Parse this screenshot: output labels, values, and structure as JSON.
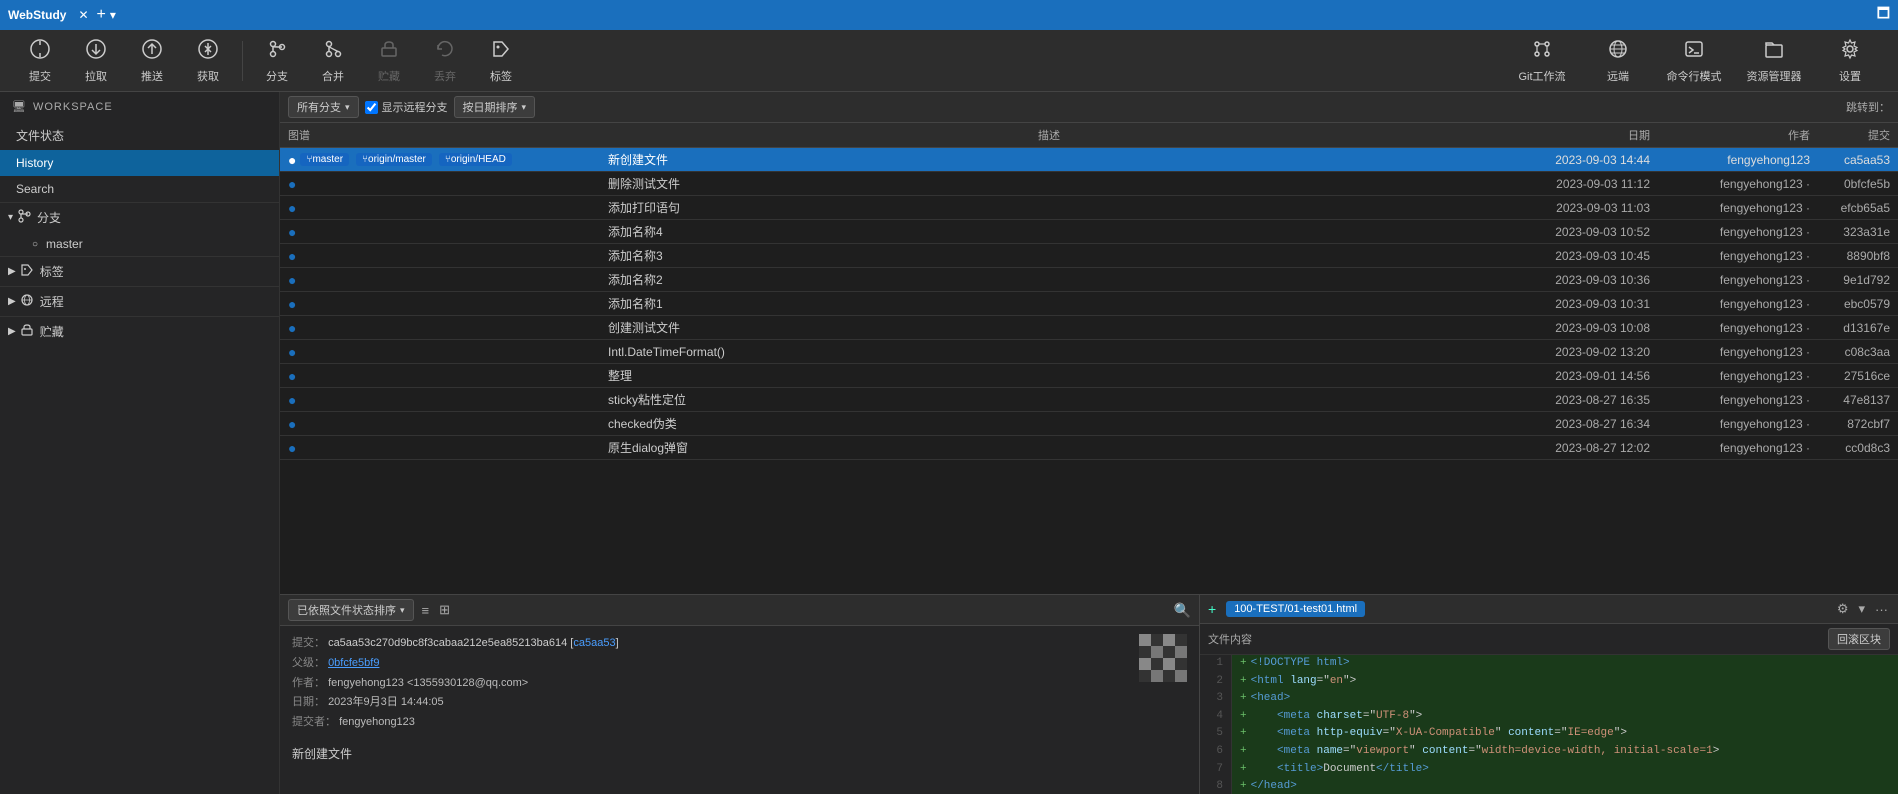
{
  "titleBar": {
    "title": "WebStudy",
    "addLabel": "+",
    "dropdownLabel": "▾",
    "maximizeLabel": "🗖"
  },
  "toolbar": {
    "items": [
      {
        "id": "commit",
        "icon": "⊕",
        "label": "提交"
      },
      {
        "id": "pull",
        "icon": "⬇",
        "label": "拉取"
      },
      {
        "id": "push",
        "icon": "⬆",
        "label": "推送"
      },
      {
        "id": "fetch",
        "icon": "⬇⬆",
        "label": "获取"
      },
      {
        "id": "branch",
        "icon": "⑂",
        "label": "分支"
      },
      {
        "id": "merge",
        "icon": "⑃",
        "label": "合并"
      },
      {
        "id": "stash",
        "icon": "☁",
        "label": "贮藏"
      },
      {
        "id": "discard",
        "icon": "↺",
        "label": "丢弃"
      },
      {
        "id": "tag",
        "icon": "⬡",
        "label": "标签"
      }
    ],
    "rightItems": [
      {
        "id": "gitflow",
        "icon": "⑂⑂",
        "label": "Git工作流"
      },
      {
        "id": "remote",
        "icon": "🌐",
        "label": "远端"
      },
      {
        "id": "terminal",
        "icon": "⌨",
        "label": "命令行模式"
      },
      {
        "id": "filemanager",
        "icon": "📁",
        "label": "资源管理器"
      },
      {
        "id": "settings",
        "icon": "⚙",
        "label": "设置"
      }
    ]
  },
  "sidebar": {
    "workspaceLabel": "WORKSPACE",
    "fileStatusLabel": "文件状态",
    "historyLabel": "History",
    "searchLabel": "Search",
    "groups": [
      {
        "id": "branch",
        "icon": "⑂",
        "label": "分支",
        "expanded": true,
        "items": [
          {
            "id": "master",
            "label": "master",
            "active": true
          }
        ]
      },
      {
        "id": "tags",
        "icon": "⬡",
        "label": "标签",
        "expanded": false,
        "items": []
      },
      {
        "id": "remote",
        "icon": "☁",
        "label": "远程",
        "expanded": false,
        "items": []
      },
      {
        "id": "stash",
        "icon": "📦",
        "label": "贮藏",
        "expanded": false,
        "items": []
      }
    ]
  },
  "commitPane": {
    "filterLabel": "所有分支",
    "showRemoteLabel": "显示远程分支",
    "sortLabel": "按日期排序",
    "jumpToLabel": "跳转到：",
    "columns": {
      "graph": "图谱",
      "desc": "描述",
      "date": "日期",
      "author": "作者",
      "commit": "提交"
    },
    "commits": [
      {
        "id": "c1",
        "selected": true,
        "hasBranches": true,
        "branches": [
          "master",
          "origin/master",
          "origin/HEAD"
        ],
        "desc": "新创建文件",
        "date": "2023-09-03 14:44",
        "author": "fengyehong123",
        "commitHash": "ca5aa53"
      },
      {
        "id": "c2",
        "selected": false,
        "hasBranches": false,
        "branches": [],
        "desc": "删除测试文件",
        "date": "2023-09-03 11:12",
        "author": "fengyehong123 ·",
        "commitHash": "0bfcfe5b"
      },
      {
        "id": "c3",
        "selected": false,
        "hasBranches": false,
        "branches": [],
        "desc": "添加打印语句",
        "date": "2023-09-03 11:03",
        "author": "fengyehong123 ·",
        "commitHash": "efcb65a5"
      },
      {
        "id": "c4",
        "selected": false,
        "hasBranches": false,
        "branches": [],
        "desc": "添加名称4",
        "date": "2023-09-03 10:52",
        "author": "fengyehong123 ·",
        "commitHash": "323a31e"
      },
      {
        "id": "c5",
        "selected": false,
        "hasBranches": false,
        "branches": [],
        "desc": "添加名称3",
        "date": "2023-09-03 10:45",
        "author": "fengyehong123 ·",
        "commitHash": "8890bf8"
      },
      {
        "id": "c6",
        "selected": false,
        "hasBranches": false,
        "branches": [],
        "desc": "添加名称2",
        "date": "2023-09-03 10:36",
        "author": "fengyehong123 ·",
        "commitHash": "9e1d792"
      },
      {
        "id": "c7",
        "selected": false,
        "hasBranches": false,
        "branches": [],
        "desc": "添加名称1",
        "date": "2023-09-03 10:31",
        "author": "fengyehong123 ·",
        "commitHash": "ebc0579"
      },
      {
        "id": "c8",
        "selected": false,
        "hasBranches": false,
        "branches": [],
        "desc": "创建测试文件",
        "date": "2023-09-03 10:08",
        "author": "fengyehong123 ·",
        "commitHash": "d13167e"
      },
      {
        "id": "c9",
        "selected": false,
        "hasBranches": false,
        "branches": [],
        "desc": "Intl.DateTimeFormat()",
        "date": "2023-09-02 13:20",
        "author": "fengyehong123 ·",
        "commitHash": "c08c3aa"
      },
      {
        "id": "c10",
        "selected": false,
        "hasBranches": false,
        "branches": [],
        "desc": "整理",
        "date": "2023-09-01 14:56",
        "author": "fengyehong123 ·",
        "commitHash": "27516ce"
      },
      {
        "id": "c11",
        "selected": false,
        "hasBranches": false,
        "branches": [],
        "desc": "sticky粘性定位",
        "date": "2023-08-27 16:35",
        "author": "fengyehong123 ·",
        "commitHash": "47e8137"
      },
      {
        "id": "c12",
        "selected": false,
        "hasBranches": false,
        "branches": [],
        "desc": "checked伪类",
        "date": "2023-08-27 16:34",
        "author": "fengyehong123 ·",
        "commitHash": "872cbf7"
      },
      {
        "id": "c13",
        "selected": false,
        "hasBranches": false,
        "branches": [],
        "desc": "原生dialog弹窗",
        "date": "2023-08-27 12:02",
        "author": "fengyehong123 ·",
        "commitHash": "cc0d8c3"
      }
    ]
  },
  "bottomPane": {
    "filterLabel": "已依照文件状态排序",
    "listIcon": "≡",
    "detailsIcon": "⊞",
    "commitDetails": {
      "commitLabel": "提交：",
      "commitHash": "ca5aa53c270d9bc8f3cabaa212e5ea85213ba614 [ca5aa53]",
      "parentLabel": "父级：",
      "parentHash": "0bfcfe5bf9",
      "authorLabel": "作者：",
      "authorValue": "fengyehong123 <1355930128@qq.com>",
      "dateLabel": "日期：",
      "dateValue": "2023年9月3日 14:44:05",
      "committerLabel": "提交者：",
      "committerValue": "fengyehong123",
      "message": "新创建文件"
    },
    "filePane": {
      "fileName": "100-TEST/01-test01.html",
      "fileHeader": "文件内容",
      "rollbackLabel": "回滚区块",
      "lines": [
        {
          "num": 1,
          "content": "+ <!DOCTYPE html>",
          "added": true
        },
        {
          "num": 2,
          "content": "+ <html lang=\"en\">",
          "added": true
        },
        {
          "num": 3,
          "content": "+ <head>",
          "added": true
        },
        {
          "num": 4,
          "content": "+     <meta charset=\"UTF-8\">",
          "added": true
        },
        {
          "num": 5,
          "content": "+     <meta http-equiv=\"X-UA-Compatible\" content=\"IE=edge\">",
          "added": true
        },
        {
          "num": 6,
          "content": "+     <meta name=\"viewport\" content=\"width=device-width, initial-scale=1>",
          "added": true
        },
        {
          "num": 7,
          "content": "+     <title>Document</title>",
          "added": true
        },
        {
          "num": 8,
          "content": "+ </head>",
          "added": true
        }
      ]
    }
  }
}
